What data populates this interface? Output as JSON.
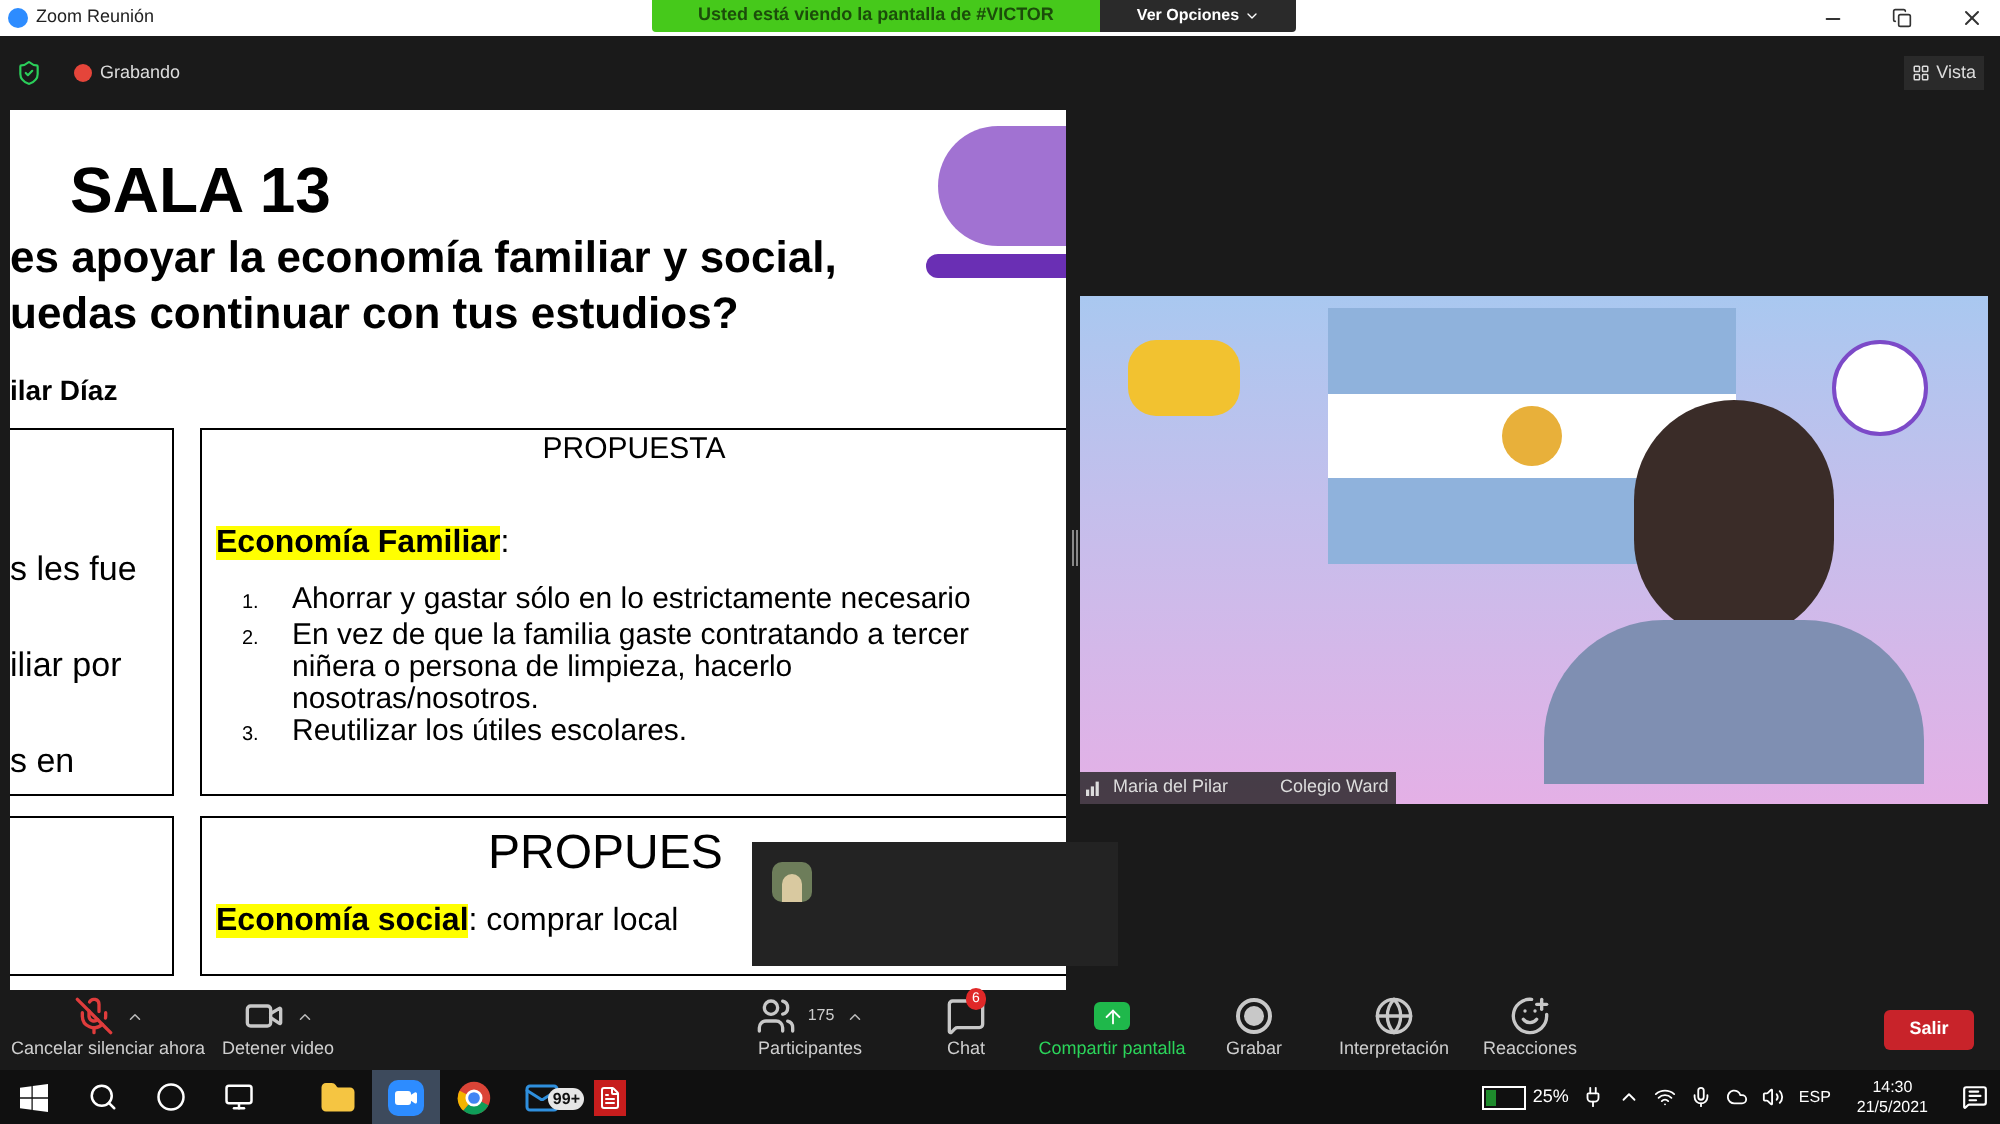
{
  "window": {
    "title": "Zoom Reunión"
  },
  "share_banner": {
    "text": "Usted está viendo la pantalla de #VICTOR",
    "options_button": "Ver Opciones"
  },
  "meeting_bar": {
    "recording_label": "Grabando",
    "view_button": "Vista"
  },
  "slide": {
    "title": "SALA 13",
    "question_lines": [
      "es apoyar la economía familiar y social,",
      "uedas continuar con tus estudios?"
    ],
    "author": "ilar Díaz",
    "rows": [
      {
        "left_lines": [
          "s les fue",
          "iliar por",
          "s en"
        ],
        "heading": "PROPUESTA",
        "lead_highlight": "Economía Familiar",
        "lead_rest": ":",
        "items": [
          {
            "number": "1.",
            "lines": [
              "Ahorrar y gastar sólo en lo estrictamente necesario"
            ]
          },
          {
            "number": "2.",
            "lines": [
              "En vez de que la familia gaste contratando a tercer",
              "niñera o persona de limpieza, hacerlo",
              "nosotras/nosotros."
            ]
          },
          {
            "number": "3.",
            "lines": [
              "Reutilizar los útiles escolares."
            ]
          }
        ]
      },
      {
        "left_lines": [],
        "heading": "PROPUES",
        "lead_highlight": "Economía social",
        "lead_rest": ": comprar local",
        "items": []
      }
    ]
  },
  "video": {
    "name": "Maria del Pilar",
    "organization": "Colegio Ward"
  },
  "toolbar": {
    "items": [
      {
        "kind": "mic",
        "label": "Cancelar silenciar ahora",
        "muted": true,
        "menu": true
      },
      {
        "kind": "video",
        "label": "Detener video",
        "menu": true
      },
      {
        "kind": "participants",
        "label": "Participantes",
        "count": "175",
        "menu": true
      },
      {
        "kind": "chat",
        "label": "Chat",
        "badge": "6",
        "menu": false
      },
      {
        "kind": "share",
        "label": "Compartir pantalla",
        "menu": false
      },
      {
        "kind": "record",
        "label": "Grabar",
        "menu": false
      },
      {
        "kind": "interpretation",
        "label": "Interpretación",
        "menu": false
      },
      {
        "kind": "reactions",
        "label": "Reacciones",
        "menu": false
      }
    ],
    "leave_button": "Salir"
  },
  "taskbar": {
    "apps": [
      {
        "kind": "start",
        "selected": false
      },
      {
        "kind": "search",
        "selected": false
      },
      {
        "kind": "cortana",
        "selected": false
      },
      {
        "kind": "taskview",
        "selected": false
      },
      {
        "kind": "folder",
        "selected": false
      },
      {
        "kind": "zoom",
        "selected": true
      },
      {
        "kind": "browser",
        "selected": false
      },
      {
        "kind": "mail",
        "badge": "99+",
        "selected": false
      },
      {
        "kind": "pdf",
        "selected": false
      }
    ],
    "battery": {
      "reading": "25%",
      "level": 0.25
    },
    "language": "ESP",
    "time": "14:30",
    "date": "21/5/2021"
  }
}
